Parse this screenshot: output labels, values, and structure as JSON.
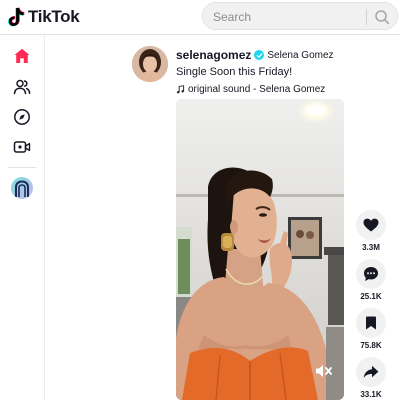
{
  "app": {
    "logo_text": "TikTok",
    "brand_color": "#fe2c55"
  },
  "search": {
    "placeholder": "Search",
    "icon": "search-icon"
  },
  "sidebar": {
    "items": [
      {
        "name": "home",
        "icon": "home-icon",
        "active": true
      },
      {
        "name": "following",
        "icon": "following-icon",
        "active": false
      },
      {
        "name": "explore",
        "icon": "explore-icon",
        "active": false
      },
      {
        "name": "live",
        "icon": "live-icon",
        "active": false
      }
    ],
    "following_account_icon": "account-avatar"
  },
  "post": {
    "username": "selenagomez",
    "verified": true,
    "nickname": "Selena Gomez",
    "caption": "Single Soon this Friday!",
    "sound": "original sound - Selena Gomez"
  },
  "actions": {
    "like_count": "3.3M",
    "comment_count": "25.1K",
    "save_count": "75.8K",
    "share_count": "33.1K"
  },
  "video": {
    "muted": true
  }
}
